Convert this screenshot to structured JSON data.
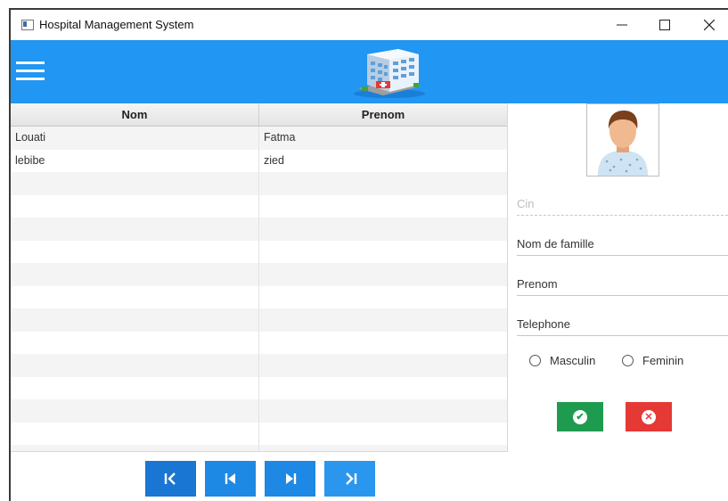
{
  "window": {
    "title": "Hospital Management System"
  },
  "table": {
    "columns": [
      "Nom",
      "Prenom"
    ],
    "rows": [
      {
        "nom": "Louati",
        "prenom": "Fatma"
      },
      {
        "nom": "lebibe",
        "prenom": "zied"
      }
    ]
  },
  "form": {
    "cin_placeholder": "Cin",
    "nom_famille_label": "Nom de famille",
    "prenom_label": "Prenom",
    "telephone_label": "Telephone",
    "gender_options": [
      "Masculin",
      "Feminin"
    ]
  },
  "colors": {
    "header": "#2196f3",
    "save": "#1f9b4f",
    "cancel": "#e53935",
    "pager": "#1e88e5"
  },
  "icons": [
    "menu-icon",
    "hospital-building-icon",
    "patient-avatar-icon",
    "first-page-icon",
    "previous-icon",
    "next-icon",
    "last-page-icon",
    "check-icon",
    "close-icon"
  ]
}
